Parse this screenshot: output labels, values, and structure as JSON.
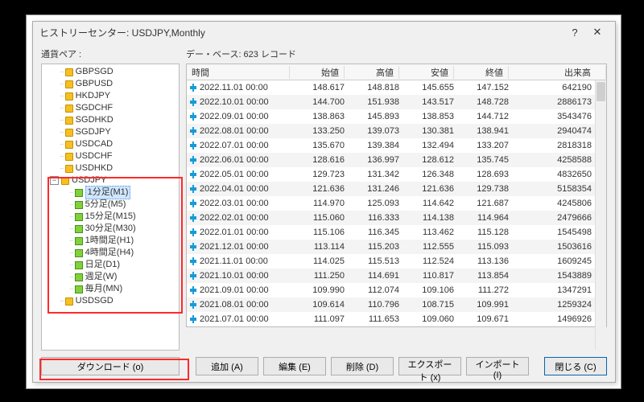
{
  "title": "ヒストリーセンター: USDJPY,Monthly",
  "help_glyph": "?",
  "close_glyph": "✕",
  "left_label": "通貨ペア :",
  "db_info": "デー・ベース: 623 レコード",
  "tree": {
    "pairs_top": [
      "GBPSGD",
      "GBPUSD",
      "HKDJPY",
      "SGDCHF",
      "SGDHKD",
      "SGDJPY",
      "USDCAD",
      "USDCHF",
      "USDHKD"
    ],
    "selected_pair": "USDJPY",
    "timeframes": [
      {
        "label": "1分足(M1)",
        "selected": true
      },
      {
        "label": "5分足(M5)"
      },
      {
        "label": "15分足(M15)"
      },
      {
        "label": "30分足(M30)"
      },
      {
        "label": "1時間足(H1)"
      },
      {
        "label": "4時間足(H4)"
      },
      {
        "label": "日足(D1)"
      },
      {
        "label": "週足(W)"
      },
      {
        "label": "毎月(MN)"
      }
    ],
    "pairs_bottom": [
      "USDSGD"
    ]
  },
  "columns": [
    "時間",
    "始値",
    "高値",
    "安値",
    "終値",
    "出来高"
  ],
  "rows": [
    [
      "2022.11.01 00:00",
      "148.617",
      "148.818",
      "145.655",
      "147.152",
      "642190"
    ],
    [
      "2022.10.01 00:00",
      "144.700",
      "151.938",
      "143.517",
      "148.728",
      "2886173"
    ],
    [
      "2022.09.01 00:00",
      "138.863",
      "145.893",
      "138.853",
      "144.712",
      "3543476"
    ],
    [
      "2022.08.01 00:00",
      "133.250",
      "139.073",
      "130.381",
      "138.941",
      "2940474"
    ],
    [
      "2022.07.01 00:00",
      "135.670",
      "139.384",
      "132.494",
      "133.207",
      "2818318"
    ],
    [
      "2022.06.01 00:00",
      "128.616",
      "136.997",
      "128.612",
      "135.745",
      "4258588"
    ],
    [
      "2022.05.01 00:00",
      "129.723",
      "131.342",
      "126.348",
      "128.693",
      "4832650"
    ],
    [
      "2022.04.01 00:00",
      "121.636",
      "131.246",
      "121.636",
      "129.738",
      "5158354"
    ],
    [
      "2022.03.01 00:00",
      "114.970",
      "125.093",
      "114.642",
      "121.687",
      "4245806"
    ],
    [
      "2022.02.01 00:00",
      "115.060",
      "116.333",
      "114.138",
      "114.964",
      "2479666"
    ],
    [
      "2022.01.01 00:00",
      "115.106",
      "116.345",
      "113.462",
      "115.128",
      "1545498"
    ],
    [
      "2021.12.01 00:00",
      "113.114",
      "115.203",
      "112.555",
      "115.093",
      "1503616"
    ],
    [
      "2021.11.01 00:00",
      "114.025",
      "115.513",
      "112.524",
      "113.136",
      "1609245"
    ],
    [
      "2021.10.01 00:00",
      "111.250",
      "114.691",
      "110.817",
      "113.854",
      "1543889"
    ],
    [
      "2021.09.01 00:00",
      "109.990",
      "112.074",
      "109.106",
      "111.272",
      "1347291"
    ],
    [
      "2021.08.01 00:00",
      "109.614",
      "110.796",
      "108.715",
      "109.991",
      "1259324"
    ],
    [
      "2021.07.01 00:00",
      "111.097",
      "111.653",
      "109.060",
      "109.671",
      "1496926"
    ]
  ],
  "buttons": {
    "download": "ダウンロード (o)",
    "add": "追加 (A)",
    "edit": "編集 (E)",
    "delete": "削除 (D)",
    "export": "エクスポート (x)",
    "import": "インポート (I)",
    "close": "閉じる (C)"
  },
  "chart_data": {
    "type": "table",
    "title": "USDJPY Monthly OHLCV",
    "columns": [
      "time",
      "open",
      "high",
      "low",
      "close",
      "volume"
    ],
    "rows": [
      [
        "2022-11-01",
        148.617,
        148.818,
        145.655,
        147.152,
        642190
      ],
      [
        "2022-10-01",
        144.7,
        151.938,
        143.517,
        148.728,
        2886173
      ],
      [
        "2022-09-01",
        138.863,
        145.893,
        138.853,
        144.712,
        3543476
      ],
      [
        "2022-08-01",
        133.25,
        139.073,
        130.381,
        138.941,
        2940474
      ],
      [
        "2022-07-01",
        135.67,
        139.384,
        132.494,
        133.207,
        2818318
      ],
      [
        "2022-06-01",
        128.616,
        136.997,
        128.612,
        135.745,
        4258588
      ],
      [
        "2022-05-01",
        129.723,
        131.342,
        126.348,
        128.693,
        4832650
      ],
      [
        "2022-04-01",
        121.636,
        131.246,
        121.636,
        129.738,
        5158354
      ],
      [
        "2022-03-01",
        114.97,
        125.093,
        114.642,
        121.687,
        4245806
      ],
      [
        "2022-02-01",
        115.06,
        116.333,
        114.138,
        114.964,
        2479666
      ],
      [
        "2022-01-01",
        115.106,
        116.345,
        113.462,
        115.128,
        1545498
      ],
      [
        "2021-12-01",
        113.114,
        115.203,
        112.555,
        115.093,
        1503616
      ],
      [
        "2021-11-01",
        114.025,
        115.513,
        112.524,
        113.136,
        1609245
      ],
      [
        "2021-10-01",
        111.25,
        114.691,
        110.817,
        113.854,
        1543889
      ],
      [
        "2021-09-01",
        109.99,
        112.074,
        109.106,
        111.272,
        1347291
      ],
      [
        "2021-08-01",
        109.614,
        110.796,
        108.715,
        109.991,
        1259324
      ],
      [
        "2021-07-01",
        111.097,
        111.653,
        109.06,
        109.671,
        1496926
      ]
    ]
  }
}
